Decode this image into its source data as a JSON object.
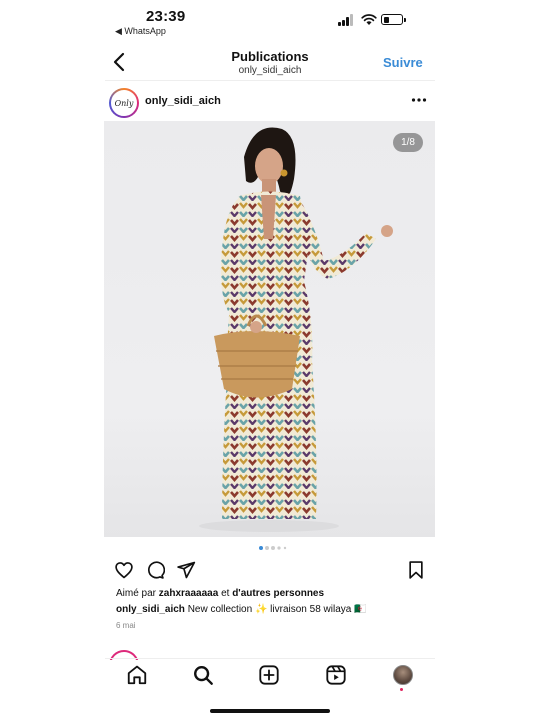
{
  "status_bar": {
    "time": "23:39",
    "back_app": "◀ WhatsApp",
    "battery_level": 0.25
  },
  "header": {
    "title": "Publications",
    "subtitle": "only_sidi_aich",
    "follow_label": "Suivre"
  },
  "post": {
    "avatar_text": "Only",
    "username": "only_sidi_aich",
    "image_counter": "1/8",
    "carousel": {
      "count": 5,
      "active": 0
    },
    "likes": {
      "prefix": "Aimé par ",
      "user": "zahxraaaaaa",
      "middle": " et ",
      "others": "d'autres personnes"
    },
    "caption": {
      "user": "only_sidi_aich",
      "text": " New collection ✨ livraison 58 wilaya 🇩🇿"
    },
    "date": "6 mai"
  },
  "colors": {
    "accent": "#3a8bd6",
    "text": "#111111",
    "muted": "#888888",
    "notification": "#e0245e"
  },
  "icons": {
    "back": "chevron-left-icon",
    "more": "more-horizontal-icon",
    "like": "heart-icon",
    "comment": "comment-icon",
    "share": "send-icon",
    "save": "bookmark-icon",
    "home": "home-icon",
    "search": "search-icon",
    "create": "add-post-icon",
    "reels": "reels-icon"
  }
}
